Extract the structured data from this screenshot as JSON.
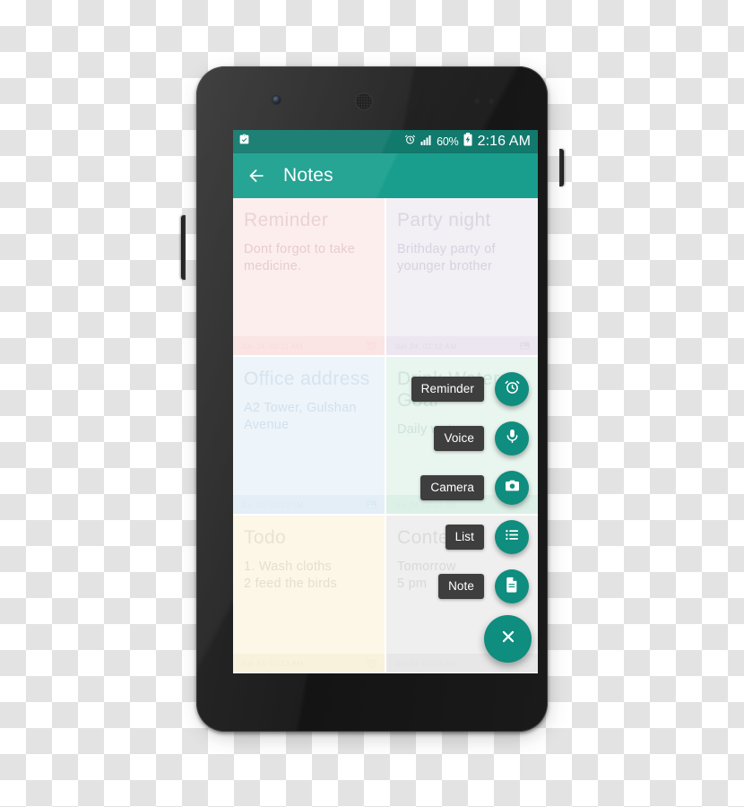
{
  "device": {
    "name": "android-smartphone",
    "hardware": {
      "front_camera": "front-camera",
      "earpiece": "earpiece-speaker",
      "power_button": "power-button",
      "volume_button": "volume-rocker"
    }
  },
  "status_bar": {
    "left_icons": [
      "clipboard-check-icon"
    ],
    "right_icons": [
      "alarm-icon",
      "signal-bars-icon",
      "battery-charging-icon"
    ],
    "battery_percent": "60%",
    "time": "2:16 AM",
    "background": "#12796d"
  },
  "app_bar": {
    "back_icon": "back-arrow-icon",
    "title": "Notes",
    "background": "#199e8d"
  },
  "notes": [
    {
      "title": "Reminder",
      "text": "Dont forgot to take medicine.",
      "date": "Jun 24, 02:11 AM",
      "icon": "alarm-icon",
      "bg": "#fdeeee",
      "footer_bg": "#fbe4e4",
      "title_color": "#ebd2d2",
      "text_color": "#e7cccc",
      "date_color": "#fbdada"
    },
    {
      "title": "Party night",
      "text": "Brithday party of younger brother",
      "date": "Jun 24, 02:12 AM",
      "icon": "image-icon",
      "bg": "#f2eff5",
      "footer_bg": "#ebe6f0",
      "title_color": "#dcd6e2",
      "text_color": "#d9d2e0",
      "date_color": "#e2dbe9"
    },
    {
      "title": "Office address",
      "text": "A2 Tower, Gulshan Avenue",
      "date": "Jun 24, 02:13 AM",
      "icon": "image-icon",
      "bg": "#edf4fa",
      "footer_bg": "#e3eef7",
      "title_color": "#d5e4ef",
      "text_color": "#d2e1ed",
      "date_color": "#dbeaf5"
    },
    {
      "title": "Drink Water Goal",
      "text": "Daily water",
      "date": "Jun 24, 02:13 AM",
      "icon": "alarm-icon",
      "bg": "#e9f5ef",
      "footer_bg": "#ddf0e7",
      "title_color": "#cfe6da",
      "text_color": "#cde4d8",
      "date_color": "#d6ebe0"
    },
    {
      "title": "Todo",
      "text": "1. Wash cloths\n2 feed the birds",
      "date": "Jun 24, 02:13 AM",
      "icon": "alarm-icon",
      "bg": "#fdf7e8",
      "footer_bg": "#f8f1dc",
      "title_color": "#eae3d0",
      "text_color": "#e6dfcb",
      "date_color": "#f2ebd6"
    },
    {
      "title": "Contest",
      "text": "Tomorrow\n5 pm",
      "date": "Jun 24, 02:14 AM",
      "icon": "alarm-icon",
      "bg": "#f0efef",
      "footer_bg": "#e8e7e7",
      "title_color": "#dcdbdb",
      "text_color": "#d9d8d8",
      "date_color": "#e3e2e2"
    }
  ],
  "fab_menu": {
    "accent": "#0f8d7e",
    "items": [
      {
        "label": "Reminder",
        "icon": "alarm-icon"
      },
      {
        "label": "Voice",
        "icon": "microphone-icon"
      },
      {
        "label": "Camera",
        "icon": "camera-icon"
      },
      {
        "label": "List",
        "icon": "list-icon"
      },
      {
        "label": "Note",
        "icon": "document-icon"
      }
    ],
    "main_icon": "close-icon"
  }
}
